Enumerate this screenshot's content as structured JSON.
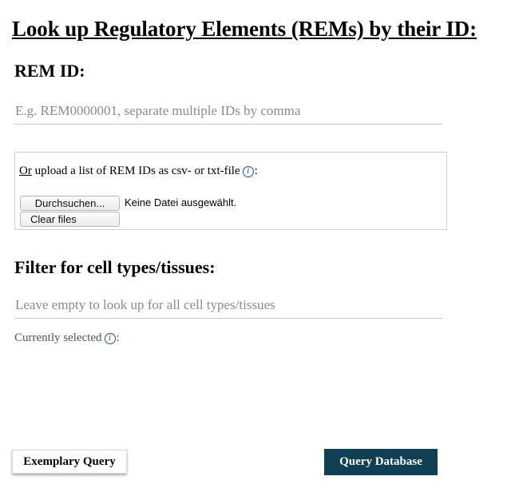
{
  "page_title": "Look up Regulatory Elements (REMs) by their ID:",
  "rem_section": {
    "heading": "REM ID:",
    "input_placeholder": "E.g. REM0000001, separate multiple IDs by comma",
    "input_value": ""
  },
  "upload": {
    "or_text": "Or",
    "prompt": " upload a list of REM IDs as csv- or txt-file",
    "info_icon": "info-icon",
    "colon": ":",
    "browse_label": "Durchsuchen...",
    "file_status": "Keine Datei ausgewählt.",
    "clear_label": "Clear files"
  },
  "filter_section": {
    "heading": "Filter for cell types/tissues:",
    "input_placeholder": "Leave empty to look up for all cell types/tissues",
    "input_value": "",
    "selected_label": "Currently selected",
    "selected_info_icon": "info-icon",
    "selected_colon": ":"
  },
  "actions": {
    "exemplary_label": "Exemplary Query",
    "query_label": "Query Database"
  },
  "colors": {
    "primary_button": "#0f3f52",
    "info_icon": "#1f4e8c"
  }
}
